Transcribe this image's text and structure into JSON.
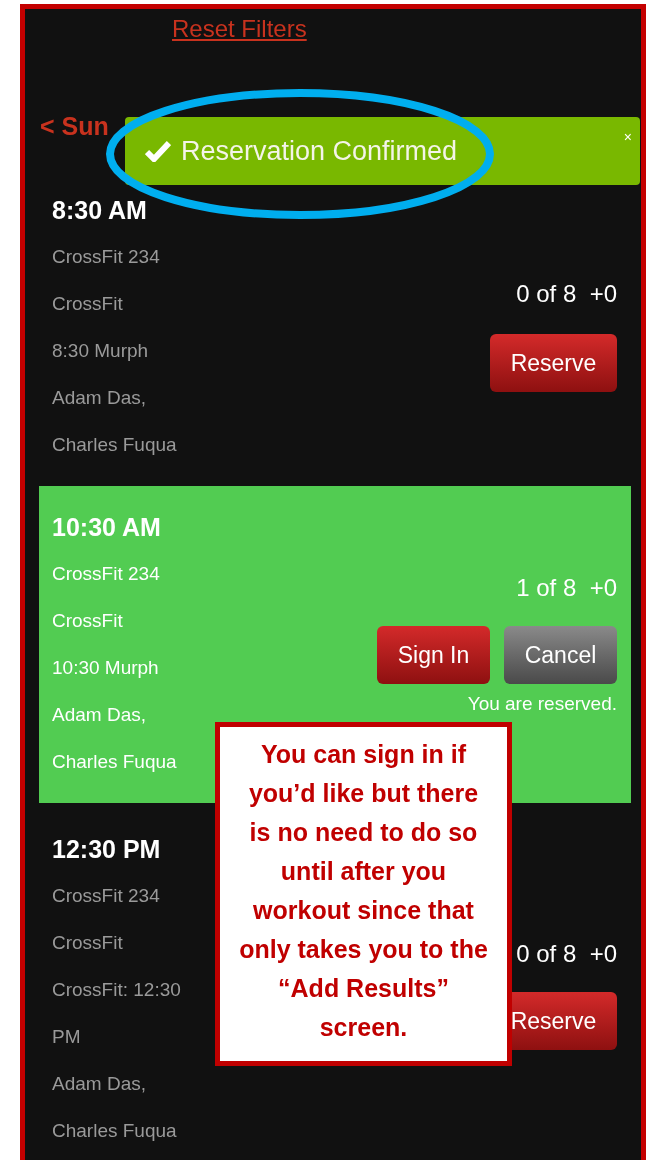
{
  "header": {
    "reset_link": "Reset Filters",
    "date_nav": "< Sun"
  },
  "toast": {
    "message": "Reservation Confirmed",
    "close": "×"
  },
  "classes": [
    {
      "time": "8:30 AM",
      "details": [
        "CrossFit 234",
        "CrossFit",
        "8:30 Murph",
        "Adam Das,",
        "Charles Fuqua"
      ],
      "count": "0 of 8  +0",
      "reserved": false,
      "buttons": [
        {
          "kind": "reserve",
          "label": "Reserve"
        }
      ]
    },
    {
      "time": "10:30 AM",
      "details": [
        "CrossFit 234",
        "CrossFit",
        "10:30 Murph",
        "Adam Das,",
        "Charles Fuqua"
      ],
      "count": "1 of 8  +0",
      "reserved": true,
      "buttons": [
        {
          "kind": "sign_in",
          "label": "Sign In"
        },
        {
          "kind": "cancel",
          "label": "Cancel"
        }
      ],
      "status": "You are reserved."
    },
    {
      "time": "12:30 PM",
      "details": [
        "CrossFit 234",
        "CrossFit",
        "CrossFit: 12:30 PM",
        "Adam Das,",
        "Charles Fuqua"
      ],
      "count": "0 of 8  +0",
      "reserved": false,
      "buttons": [
        {
          "kind": "reserve",
          "label": "Reserve"
        }
      ]
    }
  ],
  "annotation": {
    "callout": "You can sign in if you’d like but there is no need to do so until after you workout since that only takes you to the “Add Results” screen."
  }
}
